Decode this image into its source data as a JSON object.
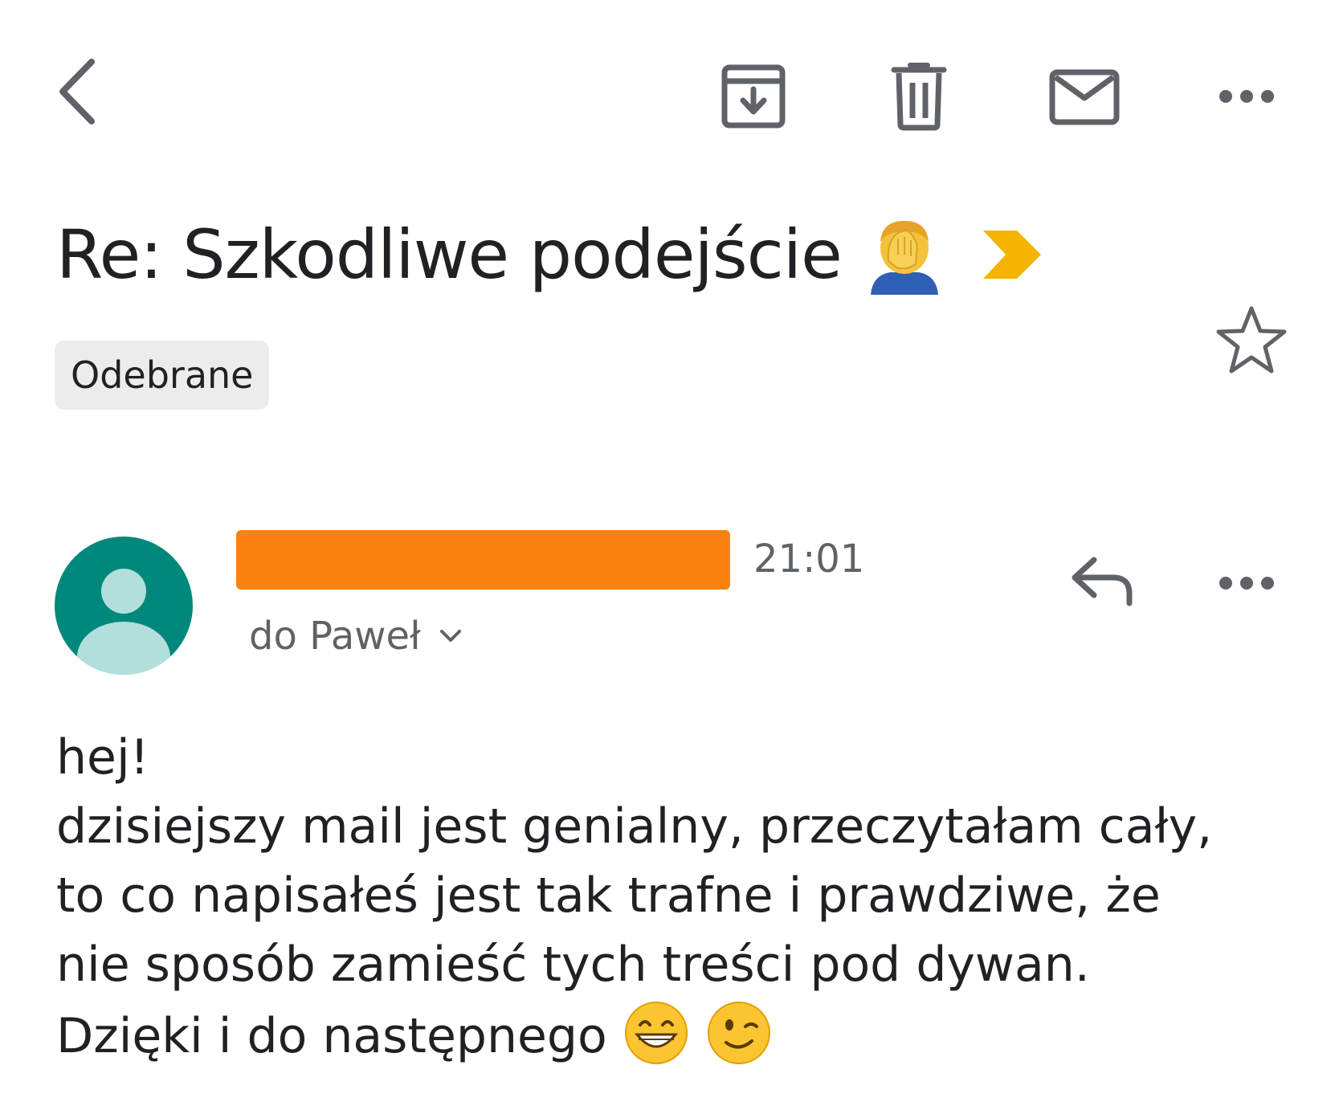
{
  "toolbar": {
    "back_icon": "chevron-left-icon",
    "archive_icon": "archive-icon",
    "delete_icon": "trash-icon",
    "mark_unread_icon": "mail-icon",
    "more_icon": "more-horizontal-icon"
  },
  "email": {
    "subject": "Re: Szkodliwe podejście",
    "subject_emoji": "person-facepalming-emoji",
    "important_marker": "importance-marker-icon",
    "label": "Odebrane",
    "starred": false,
    "sender": {
      "avatar_icon": "default-avatar-icon",
      "time": "21:01",
      "recipient": "do Paweł"
    },
    "body_lines": [
      "hej!",
      "dzisiejszy mail jest genialny, przeczytałam cały,",
      "to co napisałeś jest tak trafne i prawdziwe, że",
      "nie sposób zamieść tych treści pod dywan.",
      "Dzięki i do następnego"
    ],
    "body_emojis": [
      "grinning-face-emoji",
      "winking-face-emoji"
    ]
  },
  "colors": {
    "text": "#202124",
    "secondary_text": "#5f6368",
    "icon": "#5f6368",
    "avatar_bg": "#00897b",
    "avatar_fg": "#b2dfdb",
    "important": "#f4b400",
    "redaction": "#fb8211",
    "chip_bg": "#ececec"
  }
}
